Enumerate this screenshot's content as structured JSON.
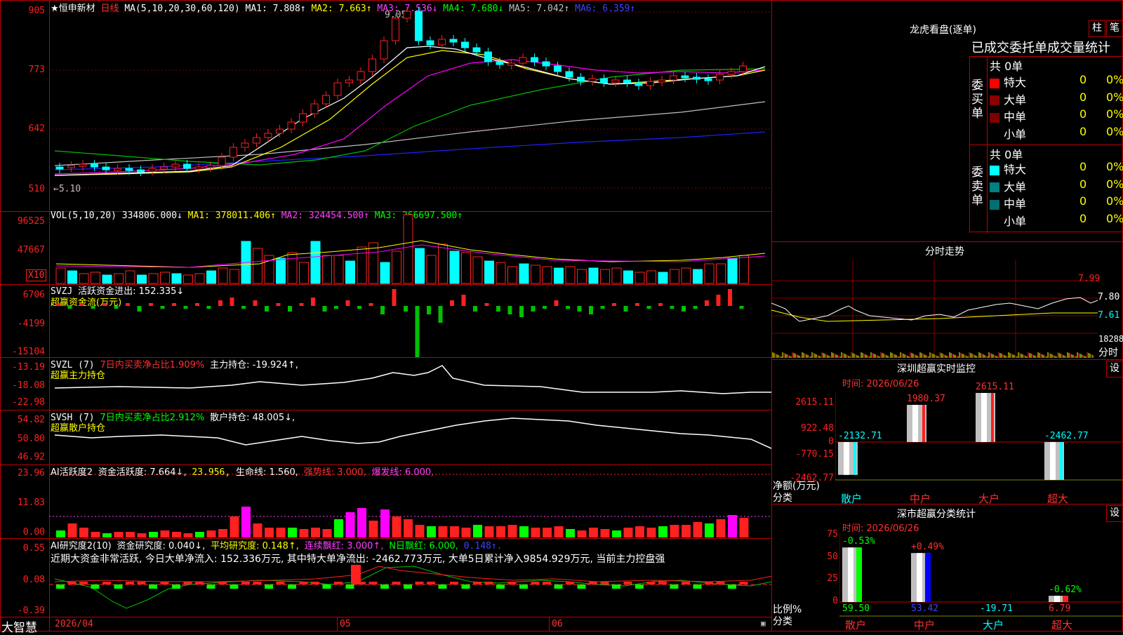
{
  "header": {
    "stock_name": "★恒申新材",
    "period": "日线",
    "ma_params": "MA(5,10,20,30,60,120)",
    "ma1": "MA1: 7.808↑",
    "ma2": "MA2: 7.663↑",
    "ma3": "MA3: 7.536↓",
    "ma4": "MA4: 7.680↓",
    "ma5": "MA5: 7.042↑",
    "ma6": "MA6: 6.359↑",
    "high_mark": "9.05",
    "low_mark": "←5.10"
  },
  "price_axis": [
    "905",
    "773",
    "642",
    "510"
  ],
  "vol": {
    "params": "VOL(5,10,20)",
    "value": "334806.000↓",
    "ma1": "MA1: 378011.406↑",
    "ma2": "MA2: 324454.500↑",
    "ma3": "MA3: 266697.500↑",
    "axis": [
      "96525",
      "47667"
    ],
    "unit": "X10"
  },
  "svzj": {
    "name": "SVZJ",
    "label": "活跃资金进出: 152.335↓",
    "subtitle": "超赢资金流(万元)",
    "axis": [
      "6706",
      "-4199",
      "-15104"
    ]
  },
  "svzl": {
    "name": "SVZL (7)",
    "ratio": "7日内买卖净占比1.909%",
    "main": "主力持仓: -19.924↑,",
    "subtitle": "超赢主力持仓",
    "axis": [
      "-13.19",
      "-18.08",
      "-22.98"
    ]
  },
  "svsh": {
    "name": "SVSH (7)",
    "ratio": "7日内买卖净占比2.912%",
    "retail": "散户持仓: 48.005↓,",
    "subtitle": "超赢散户持仓",
    "axis": [
      "54.82",
      "50.80",
      "46.92"
    ]
  },
  "ai_active": {
    "name": "AI活跃度2",
    "active": "资金活跃度: 7.664↓,",
    "v2": "23.956,",
    "life": "生命线: 1.560,",
    "strong": "强势线: 3.000,",
    "burst": "爆发线: 6.000,",
    "axis": [
      "23.96",
      "11.83",
      "0.00"
    ]
  },
  "ai_research": {
    "name": "AI研究度2(10)",
    "research": "资金研究度: 0.040↓,",
    "avg": "平均研究度: 0.148↑,",
    "cont": "连续飘红: 3.000↑,",
    "nday": "N日飘红: 6.000,",
    "v": "0.148↑.",
    "comment": "近期大资金非常活跃, 今日大单净流入: 152.336万元, 其中特大单净流出: -2462.773万元, 大单5日累计净入9854.929万元, 当前主力控盘强",
    "axis": [
      "0.55",
      "0.08",
      "-0.39"
    ]
  },
  "bottom": {
    "brand": "大智慧",
    "date": "2026/04",
    "m05": "05",
    "m06": "06"
  },
  "right": {
    "lhkp_title": "龙虎看盘(逐单)",
    "btn_zhu": "柱",
    "btn_bi": "笔",
    "tabs_label": "已成交委托单成交量统计",
    "buy_side": "委买单",
    "sell_side": "委卖单",
    "buy_total": "共 0单",
    "sell_total": "共 0单",
    "buy_rows": [
      {
        "label": "特大",
        "count": "0",
        "pct": "0%",
        "color": "#ff0000"
      },
      {
        "label": "大单",
        "count": "0",
        "pct": "0%",
        "color": "#8b0000"
      },
      {
        "label": "中单",
        "count": "0",
        "pct": "0%",
        "color": "#800000"
      },
      {
        "label": "小单",
        "count": "0",
        "pct": "0%",
        "color": "#000000"
      }
    ],
    "sell_rows": [
      {
        "label": "特大",
        "count": "0",
        "pct": "0%",
        "color": "#00ffff"
      },
      {
        "label": "大单",
        "count": "0",
        "pct": "0%",
        "color": "#008080"
      },
      {
        "label": "中单",
        "count": "0",
        "pct": "0%",
        "color": "#007070"
      },
      {
        "label": "小单",
        "count": "0",
        "pct": "0%",
        "color": "#000000"
      }
    ],
    "intraday_title": "分时走势",
    "intraday_axis": [
      "7.99",
      "7.80",
      "7.61"
    ],
    "intraday_vol": "18288",
    "intraday_unit": "分时",
    "sz_monitor_title": "深圳超赢实时监控",
    "sz_btn": "设",
    "sz_time": "时间: 2026/06/26",
    "sz_axis": [
      "2615.11",
      "922.48",
      "0",
      "-770.15",
      "-2462.77"
    ],
    "sz_ylabel": "净额(万元)",
    "sz_xlabel": "分类",
    "sz_cats": [
      "散户",
      "中户",
      "大户",
      "超大"
    ],
    "sz_values": [
      "-2132.71",
      "1980.37",
      "2615.11",
      "-2462.77"
    ],
    "stat_title": "深市超赢分类统计",
    "stat_btn": "设",
    "stat_time": "时间: 2026/06/26",
    "stat_axis": [
      "75",
      "50",
      "25",
      "0"
    ],
    "stat_ylabel": "比例%",
    "stat_xlabel": "分类",
    "stat_changes": [
      "-0.53%",
      "+0.49%",
      "",
      "-0.62%"
    ],
    "stat_values": [
      "59.50",
      "53.42",
      "-19.71",
      "6.79"
    ],
    "stat_cats": [
      "散户",
      "中户",
      "大户",
      "超大"
    ]
  }
}
